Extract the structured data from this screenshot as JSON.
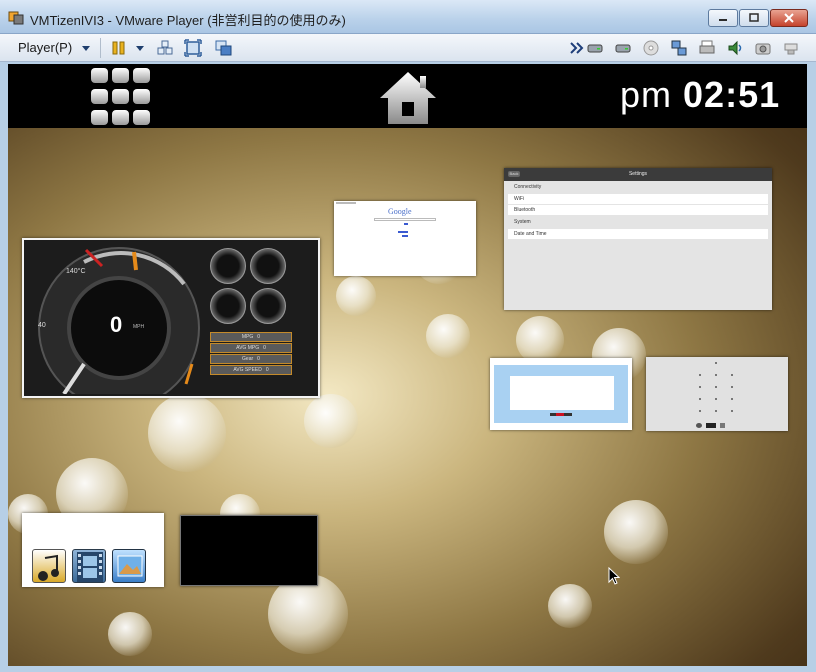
{
  "window": {
    "title": "VMTizenIVI3 - VMware Player (非営利目的の使用のみ)"
  },
  "toolbar": {
    "player_label": "Player(P)",
    "icons": [
      "pause-icon",
      "send-ctrl-alt-del-icon",
      "fullscreen-icon",
      "unity-icon",
      "expand-icon",
      "hdd-icon",
      "hdd2-icon",
      "cdrom-icon",
      "network-icon",
      "printer-icon",
      "sound-icon",
      "camera-icon",
      "usb-icon"
    ]
  },
  "tizen": {
    "clock_ampm": "pm",
    "clock_time": "02:51"
  },
  "thumbnails": {
    "dashboard": {
      "temp": "140°C",
      "temp_low": "40",
      "speed": "0",
      "speed_unit": "MPH",
      "rows": [
        {
          "label": "MPG",
          "value": "0"
        },
        {
          "label": "AVG MPG",
          "value": "0"
        },
        {
          "label": "Gear",
          "value": "0"
        },
        {
          "label": "AVG SPEED",
          "value": "0"
        }
      ]
    },
    "google": {
      "logo": "Google"
    },
    "settings": {
      "header": "Settings",
      "back": "Back",
      "sections": [
        {
          "name": "Connectivity",
          "items": [
            "WiFi",
            "Bluetooth"
          ]
        },
        {
          "name": "System",
          "items": [
            "Date and Time"
          ]
        }
      ]
    }
  },
  "colors": {
    "titlebar": "#b9d1ea",
    "topbar": "#000000",
    "accent_orange": "#c48a2a"
  }
}
